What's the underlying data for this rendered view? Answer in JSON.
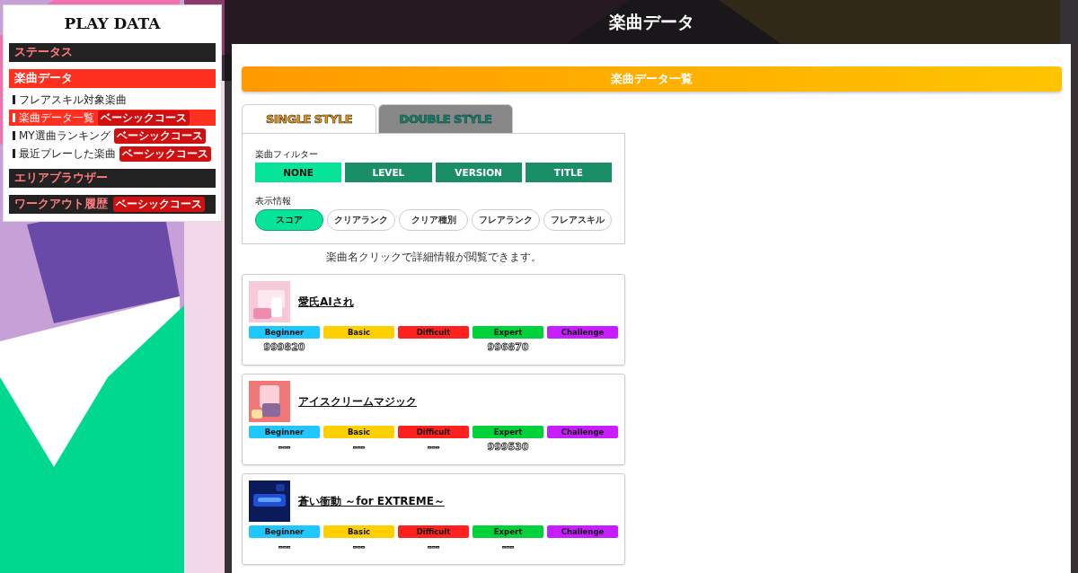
{
  "sidebar": {
    "title": "PLAY DATA",
    "items": [
      {
        "label": "ステータス",
        "selected": false
      },
      {
        "label": "楽曲データ",
        "selected": true,
        "children": [
          {
            "label": "フレアスキル対象楽曲",
            "selected": false
          },
          {
            "label": "楽曲データ一覧",
            "selected": true,
            "badge": "ベーシックコース"
          },
          {
            "label": "MY選曲ランキング",
            "selected": false,
            "badge": "ベーシックコース"
          },
          {
            "label": "最近プレーした楽曲",
            "selected": false,
            "badge": "ベーシックコース"
          }
        ]
      },
      {
        "label": "エリアブラウザー",
        "selected": false
      },
      {
        "label": "ワークアウト履歴",
        "selected": false,
        "badge": "ベーシックコース"
      }
    ]
  },
  "header": {
    "title": "楽曲データ"
  },
  "section_title": "楽曲データ一覧",
  "style_tabs": [
    {
      "label": "SINGLE STYLE",
      "selected": true
    },
    {
      "label": "DOUBLE STYLE",
      "selected": false
    }
  ],
  "filter": {
    "label": "楽曲フィルター",
    "options": [
      {
        "label": "NONE",
        "selected": true
      },
      {
        "label": "LEVEL",
        "selected": false
      },
      {
        "label": "VERSION",
        "selected": false
      },
      {
        "label": "TITLE",
        "selected": false
      }
    ]
  },
  "display": {
    "label": "表示情報",
    "options": [
      {
        "label": "スコア",
        "selected": true
      },
      {
        "label": "クリアランク",
        "selected": false
      },
      {
        "label": "クリア種別",
        "selected": false
      },
      {
        "label": "フレアランク",
        "selected": false
      },
      {
        "label": "フレアスキル",
        "selected": false
      }
    ]
  },
  "note": "楽曲名クリックで詳細情報が閲覧できます。",
  "songs": [
    {
      "title": "愛氏AIされ",
      "charts": [
        {
          "difficulty": "Beginner",
          "color": "#1ec8ff",
          "score": "999820"
        },
        {
          "difficulty": "Basic",
          "color": "#ffd000"
        },
        {
          "difficulty": "Difficult",
          "color": "#ff2020"
        },
        {
          "difficulty": "Expert",
          "color": "#00d23c",
          "score": "996870"
        },
        {
          "difficulty": "Challenge",
          "color": "#c81eff"
        }
      ]
    },
    {
      "title": "アイスクリームマジック",
      "charts": [
        {
          "difficulty": "Beginner",
          "color": "#1ec8ff",
          "score": "---"
        },
        {
          "difficulty": "Basic",
          "color": "#ffd000",
          "score": "---"
        },
        {
          "difficulty": "Difficult",
          "color": "#ff2020",
          "score": "---"
        },
        {
          "difficulty": "Expert",
          "color": "#00d23c",
          "score": "999530"
        },
        {
          "difficulty": "Challenge",
          "color": "#c81eff"
        }
      ]
    },
    {
      "title": "蒼い衝動 ～for EXTREME～",
      "charts": [
        {
          "difficulty": "Beginner",
          "color": "#1ec8ff",
          "score": "---"
        },
        {
          "difficulty": "Basic",
          "color": "#ffd000",
          "score": "---"
        },
        {
          "difficulty": "Difficult",
          "color": "#ff2020",
          "score": "---"
        },
        {
          "difficulty": "Expert",
          "color": "#00d23c",
          "score": "---"
        },
        {
          "difficulty": "Challenge",
          "color": "#c81eff"
        }
      ]
    }
  ]
}
